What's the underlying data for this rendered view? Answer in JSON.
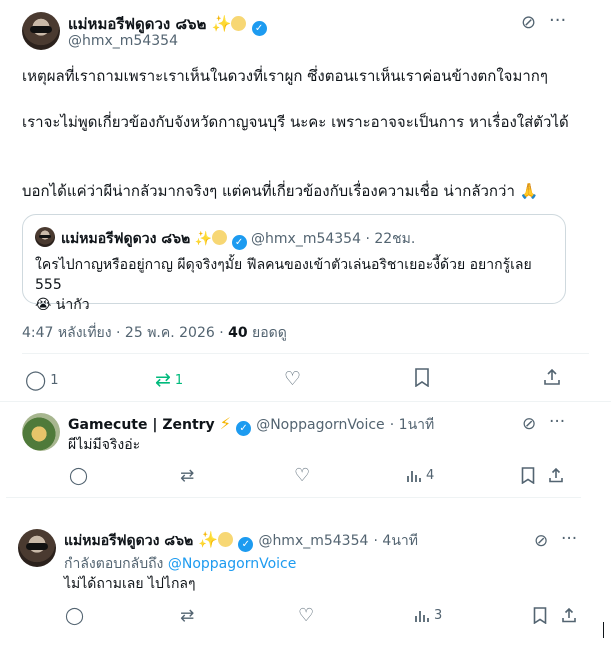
{
  "main_tweet": {
    "author_name": "แม่หมอรีฟดูดวง ๘๖๒",
    "author_handle": "@hmx_m54354",
    "paragraph_1": "เหตุผลที่เราถามเพราะเราเห็นในดวงที่เราผูก ซึ่งตอนเราเห็นเราค่อนข้างตกใจมากๆ",
    "paragraph_2": "เราจะไม่พูดเกี่ยวข้องกับจังหวัดกาญจนบุรี นะคะ เพราะอาจจะเป็นการ หาเรื่องใส่ตัวได้",
    "paragraph_3": "บอกได้แค่ว่าผีน่ากลัวมากจริงๆ แต่คนที่เกี่ยวข้องกับเรื่องความเชื่อ น่ากลัวกว่า 🙏",
    "time": "4:47 หลังเที่ยง · 25 พ.ค. 2026 · ",
    "views_count": "40",
    "views_label": " ยอดดู",
    "replies": "1",
    "reposts": "1"
  },
  "quoted": {
    "author_name": "แม่หมอรีฟดูดวง ๘๖๒",
    "author_handle": "@hmx_m54354",
    "time": "· 22ชม.",
    "line_1": "ใครไปกาญหรืออยู่กาญ ผีดุจริงๆมั้ย ฟีลคนของเข้าตัวเล่นอริชาเยอะงี้ด้วย อยากรู้เลย 555",
    "line_2": "😭 น่ากัว"
  },
  "reply_1": {
    "author_name": "Gamecute | Zentry",
    "author_handle": "@NoppagornVoice",
    "time": "· 1นาที",
    "text": "ผีไม่มีจริงอ่ะ",
    "views": "4"
  },
  "reply_2": {
    "author_name": "แม่หมอรีฟดูดวง ๘๖๒",
    "author_handle": "@hmx_m54354",
    "time": "· 4นาที",
    "replying_label": "กำลังตอบกลับถึง ",
    "replying_to": "@NoppagornVoice",
    "text": "ไม่ได้ถามเลย ไปไกลๆ",
    "views": "3"
  },
  "colors": {
    "accent": "#1d9bf0",
    "repost_active": "#00ba7c",
    "muted": "#536471"
  },
  "icons": [
    "grok-icon",
    "more-icon",
    "reply-icon",
    "repost-icon",
    "like-icon",
    "bookmark-icon",
    "share-icon",
    "views-icon",
    "verified-icon"
  ]
}
